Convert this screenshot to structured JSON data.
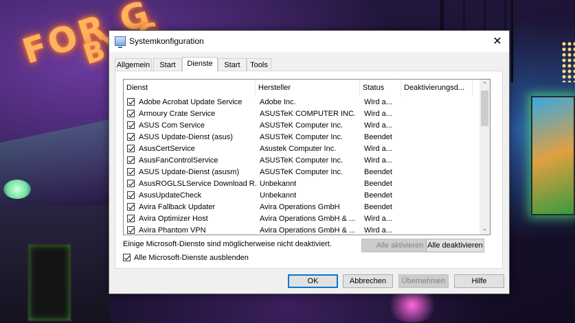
{
  "window": {
    "title": "Systemkonfiguration",
    "close_glyph": "✕"
  },
  "wallpaper": {
    "neon_text_1": "FOR G",
    "neon_text_2": "BY G"
  },
  "tabs": [
    {
      "label": "Allgemein",
      "active": false
    },
    {
      "label": "Start",
      "active": false
    },
    {
      "label": "Dienste",
      "active": true
    },
    {
      "label": "Start",
      "active": false
    },
    {
      "label": "Tools",
      "active": false
    }
  ],
  "services_list": {
    "columns": [
      "Dienst",
      "Hersteller",
      "Status",
      "Deaktivierungsd..."
    ],
    "rows": [
      {
        "name": "Adobe Acrobat Update Service",
        "manufacturer": "Adobe Inc.",
        "status": "Wird a...",
        "checked": true
      },
      {
        "name": "Armoury Crate Service",
        "manufacturer": "ASUSTeK COMPUTER INC.",
        "status": "Wird a...",
        "checked": true
      },
      {
        "name": "ASUS Com Service",
        "manufacturer": "ASUSTeK Computer Inc.",
        "status": "Wird a...",
        "checked": true
      },
      {
        "name": "ASUS Update-Dienst (asus)",
        "manufacturer": "ASUSTeK Computer Inc.",
        "status": "Beendet",
        "checked": true
      },
      {
        "name": "AsusCertService",
        "manufacturer": "Asustek Computer Inc.",
        "status": "Wird a...",
        "checked": true
      },
      {
        "name": "AsusFanControlService",
        "manufacturer": "ASUSTeK Computer Inc.",
        "status": "Wird a...",
        "checked": true
      },
      {
        "name": "ASUS Update-Dienst (asusm)",
        "manufacturer": "ASUSTeK Computer Inc.",
        "status": "Beendet",
        "checked": true
      },
      {
        "name": "AsusROGLSLService Download R...",
        "manufacturer": "Unbekannt",
        "status": "Beendet",
        "checked": true
      },
      {
        "name": "AsusUpdateCheck",
        "manufacturer": "Unbekannt",
        "status": "Beendet",
        "checked": true
      },
      {
        "name": "Avira Fallback Updater",
        "manufacturer": "Avira Operations GmbH",
        "status": "Beendet",
        "checked": true
      },
      {
        "name": "Avira Optimizer Host",
        "manufacturer": "Avira Operations GmbH & ...",
        "status": "Wird a...",
        "checked": true
      },
      {
        "name": "Avira Phantom VPN",
        "manufacturer": "Avira Operations GmbH & ...",
        "status": "Wird a...",
        "checked": true
      }
    ]
  },
  "note": "Einige Microsoft-Dienste sind möglicherweise nicht deaktiviert.",
  "buttons": {
    "enable_all": "Alle aktivieren",
    "disable_all": "Alle deaktivieren",
    "ok": "OK",
    "cancel": "Abbrechen",
    "apply": "Übernehmen",
    "help": "Hilfe"
  },
  "hide_microsoft": {
    "label": "Alle Microsoft-Dienste ausblenden",
    "checked": true
  },
  "icons": {
    "scroll_up": "⌃",
    "scroll_down": "⌄"
  }
}
